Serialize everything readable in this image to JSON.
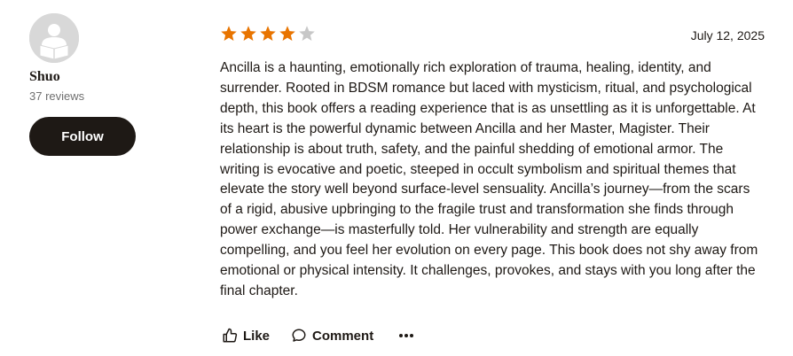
{
  "reviewer": {
    "name": "Shuo",
    "review_count": "37 reviews",
    "follow_label": "Follow",
    "avatar_icon": "reader-silhouette-icon"
  },
  "review": {
    "rating": 4,
    "max_rating": 5,
    "date": "July 12, 2025",
    "text": "Ancilla is a haunting, emotionally rich exploration of trauma, healing, identity, and surrender. Rooted in BDSM romance but laced with mysticism, ritual, and psychological depth, this book offers a reading experience that is as unsettling as it is unforgettable. At its heart is the powerful dynamic between Ancilla and her Master, Magister. Their relationship is about truth, safety, and the painful shedding of emotional armor. The writing is evocative and poetic, steeped in occult symbolism and spiritual themes that elevate the story well beyond surface-level sensuality. Ancilla’s journey—from the scars of a rigid, abusive upbringing to the fragile trust and transformation she finds through power exchange—is masterfully told. Her vulnerability and strength are equally compelling, and you feel her evolution on every page. This book does not shy away from emotional or physical intensity. It challenges, provokes, and stays with you long after the final chapter."
  },
  "actions": {
    "like_label": "Like",
    "comment_label": "Comment",
    "like_icon": "thumbs-up-icon",
    "comment_icon": "speech-bubble-icon",
    "more_icon": "more-dots-icon"
  },
  "colors": {
    "star_filled": "#e87400",
    "star_empty": "#c7c7c7",
    "text": "#1e1915",
    "muted": "#707070",
    "button_bg": "#1e1915",
    "avatar_bg": "#d8d8d8"
  }
}
